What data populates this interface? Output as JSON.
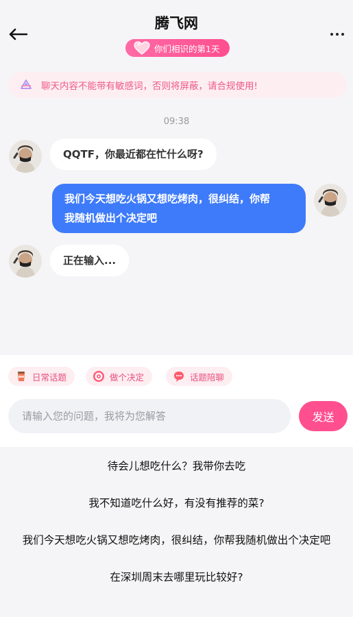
{
  "header": {
    "title": "腾飞网",
    "days_badge": "你们相识的第1天",
    "back_icon": "back-arrow-icon",
    "more_icon": "more-dots-icon"
  },
  "notice": {
    "text": "聊天内容不能带有敏感词，否则将屏蔽，请合规使用!",
    "icon": "sparkle-icon",
    "color": "#ef5a86"
  },
  "chat": {
    "timestamp": "09:38",
    "messages": [
      {
        "side": "left",
        "text": "QQTF，你最近都在忙什么呀?"
      },
      {
        "side": "right",
        "line1": "我们今天想吃火锅又想吃烤肉，很纠结，你帮",
        "line2": "我随机做出个决定吧"
      },
      {
        "side": "left",
        "text": "正在输入..."
      }
    ]
  },
  "quick_topics": [
    {
      "label": "日常话题",
      "icon": "coffee-cup-icon"
    },
    {
      "label": "做个决定",
      "icon": "target-icon"
    },
    {
      "label": "话题陪聊",
      "icon": "chat-bubble-icon"
    }
  ],
  "input": {
    "placeholder": "请输入您的问题，我将为您解答",
    "send_label": "发送"
  },
  "suggestions": [
    "待会儿想吃什么？我带你去吃",
    "我不知道吃什么好，有没有推荐的菜?",
    "我们今天想吃火锅又想吃烤肉，很纠结，你帮我随机做出个决定吧",
    "在深圳周末去哪里玩比较好?"
  ],
  "colors": {
    "accent_pink": "#ff4f8f",
    "bubble_blue": "#3e7bfa",
    "background": "#f5f5f7"
  }
}
